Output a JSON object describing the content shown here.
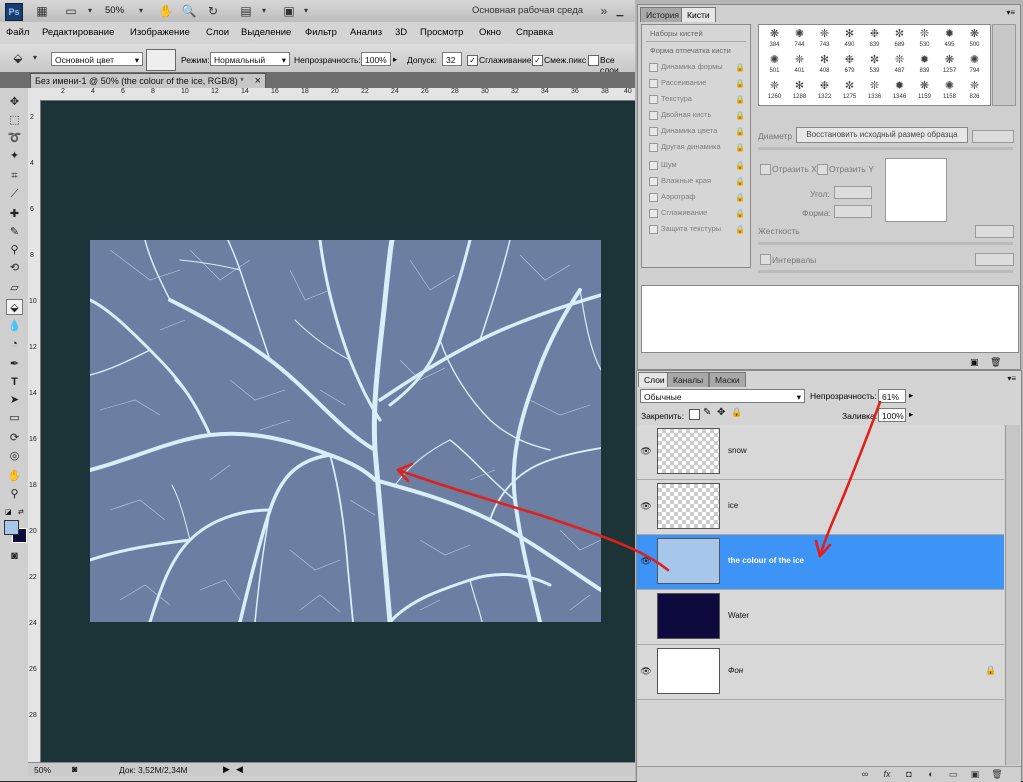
{
  "appbar": {
    "logo": "Ps",
    "zoom": "50%",
    "workspace": "Основная рабочая среда",
    "icons": [
      "br-icon",
      "layout-icon",
      "hand-icon",
      "zoom-icon",
      "rotate-icon",
      "arrange-icon",
      "screen-mode-icon"
    ]
  },
  "menu": {
    "items": [
      "Файл",
      "Редактирование",
      "Изображение",
      "Слои",
      "Выделение",
      "Фильтр",
      "Анализ",
      "3D",
      "Просмотр",
      "Окно",
      "Справка"
    ]
  },
  "options": {
    "fill_source": "Основной цвет",
    "mode_label": "Режим:",
    "mode_value": "Нормальный",
    "opacity_label": "Непрозрачность:",
    "opacity_value": "100%",
    "tolerance_label": "Допуск:",
    "tolerance_value": "32",
    "antialias_label": "Сглаживание",
    "contiguous_label": "Смеж.пикс",
    "all_layers_label": "Все слои"
  },
  "document": {
    "tab_title": "Без имени-1 @ 50% (the colour of the ice, RGB/8) *",
    "close": "×",
    "zoom_status": "50%",
    "doc_status": "Док: 3,52M/2,34M",
    "image_color": "#6c7fa3",
    "branch_color": "#d8eef8",
    "canvas_color": "#1c3438"
  },
  "rulers": {
    "h": [
      "2",
      "4",
      "6",
      "8",
      "10",
      "12",
      "14",
      "16",
      "18",
      "20",
      "22",
      "24",
      "26",
      "28",
      "30",
      "32",
      "34",
      "36",
      "38",
      "40"
    ],
    "v": [
      "2",
      "4",
      "6",
      "8",
      "10",
      "12",
      "14",
      "16",
      "18",
      "20",
      "22",
      "24",
      "26",
      "28"
    ]
  },
  "brush_panel": {
    "tabs": [
      "История",
      "Кисти"
    ],
    "presets_label": "Наборы кистей",
    "tip_shape_label": "Форма отпечатка кисти",
    "options": [
      "Динамика формы",
      "Рассеивание",
      "Текстура",
      "Двойная кисть",
      "Динамика цвета",
      "Другая динамика",
      "Шум",
      "Влажные края",
      "Аэрограф",
      "Сглаживание",
      "Защита текстуры"
    ],
    "brush_sizes": [
      "384",
      "744",
      "743",
      "490",
      "839",
      "689",
      "530",
      "495",
      "500",
      "501",
      "401",
      "408",
      "679",
      "539",
      "487",
      "839",
      "1257",
      "794",
      "1260",
      "1288",
      "1322",
      "1275",
      "1336",
      "1346",
      "1159",
      "1158",
      "826"
    ],
    "diameter_label": "Диаметр",
    "restore_label": "Восстановить исходный размер образца",
    "flip_x_label": "Отразить X",
    "flip_y_label": "Отразить Y",
    "angle_label": "Угол:",
    "roundness_label": "Форма:",
    "hardness_label": "Жесткость",
    "spacing_label": "Интервалы"
  },
  "layers_panel": {
    "tabs": [
      "Слои",
      "Каналы",
      "Маски"
    ],
    "blend_mode": "Обычные",
    "opacity_label": "Непрозрачность:",
    "opacity_value": "61%",
    "lock_label": "Закрепить:",
    "fill_label": "Заливка:",
    "fill_value": "100%",
    "layers": [
      {
        "name": "snow",
        "thumb": "transparent",
        "selected": false
      },
      {
        "name": "ice",
        "thumb": "transparent",
        "selected": false
      },
      {
        "name": "the colour of the ice",
        "thumb": "#a6c7ea",
        "selected": true
      },
      {
        "name": "Water",
        "thumb": "#0d0a3e",
        "selected": false
      },
      {
        "name": "Фон",
        "thumb": "#ffffff",
        "selected": false
      }
    ]
  }
}
